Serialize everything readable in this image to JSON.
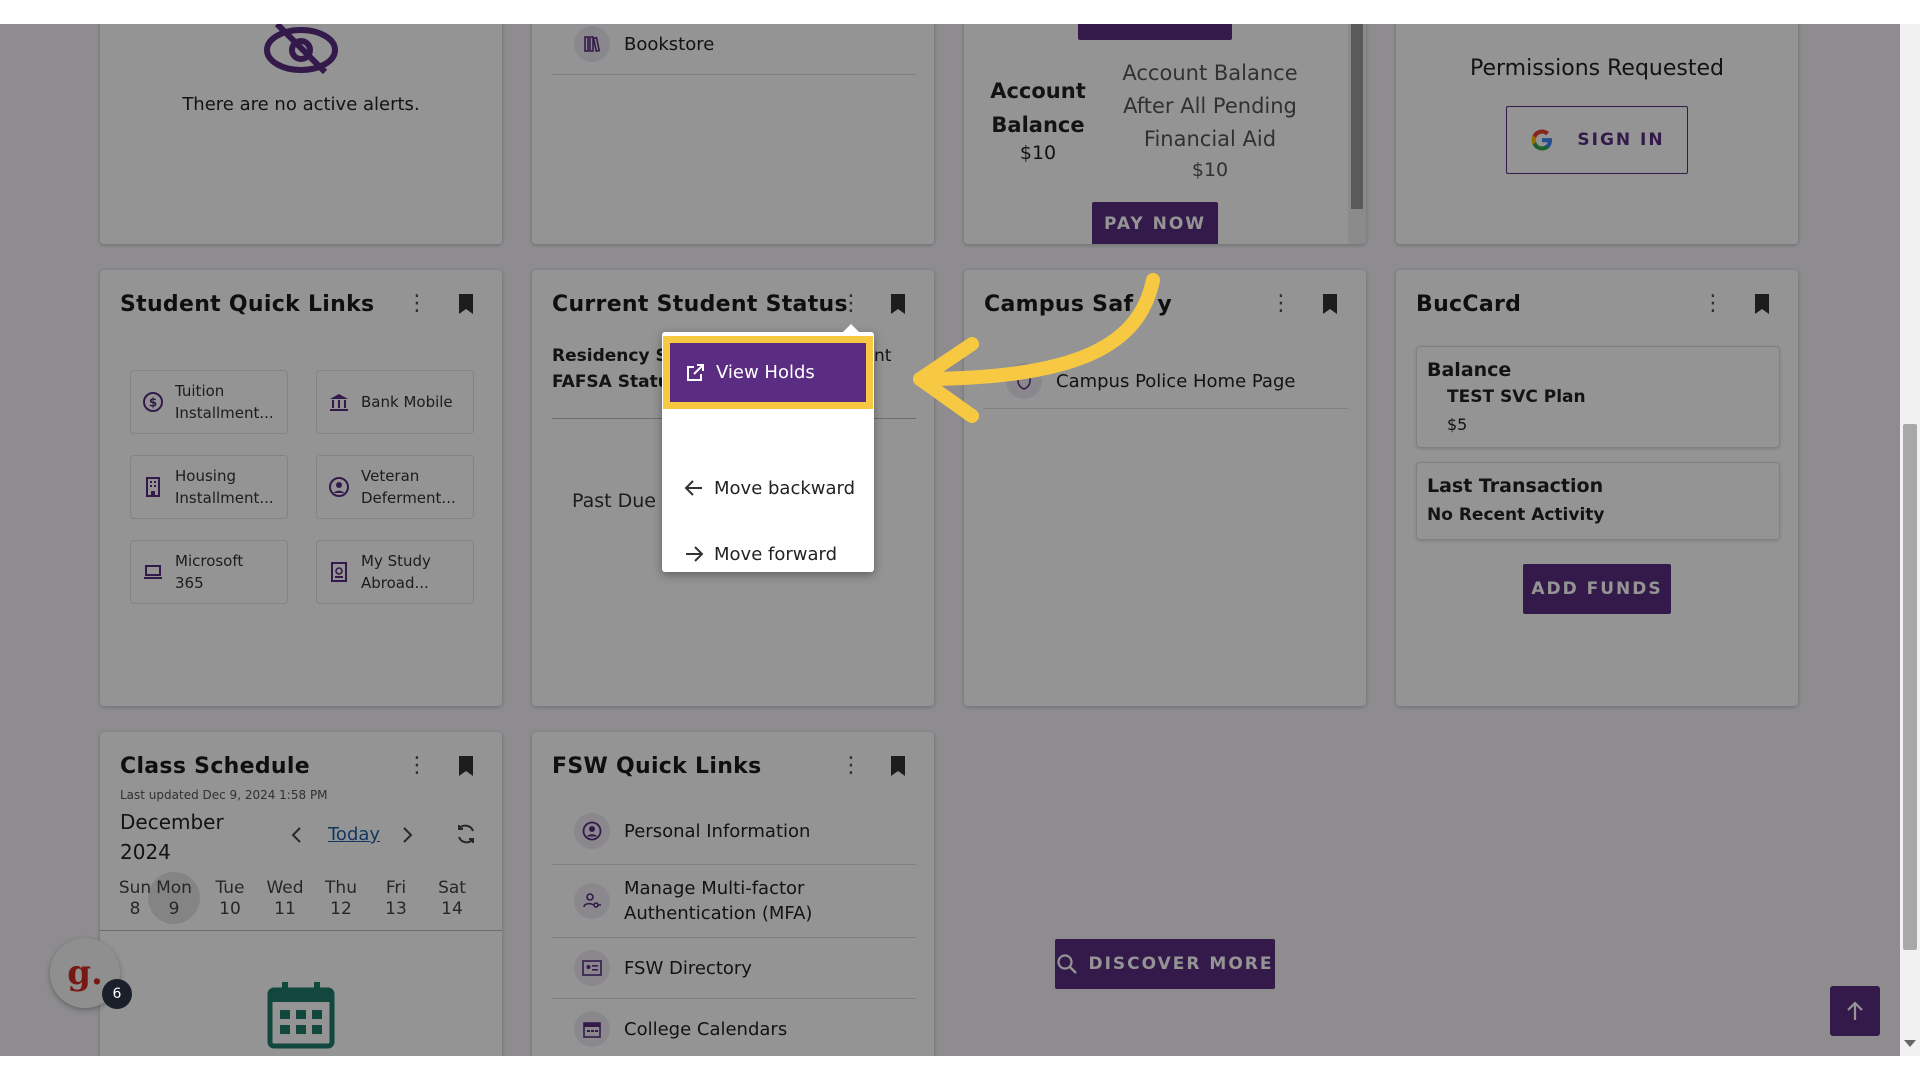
{
  "alerts": {
    "message": "There are no active alerts."
  },
  "resources": {
    "bookstore": "Bookstore"
  },
  "account": {
    "balance_label": "Account Balance",
    "balance_value": "$10",
    "pending_label": "Account Balance After All Pending Financial Aid",
    "pending_value": "$10",
    "pay_now": "PAY NOW"
  },
  "google": {
    "permissions": "Permissions Requested",
    "sign_in": "SIGN IN"
  },
  "quick_links": {
    "title": "Student Quick Links",
    "items": [
      {
        "label": "Tuition Installment...",
        "icon": "dollar-icon"
      },
      {
        "label": "Bank Mobile",
        "icon": "bank-icon"
      },
      {
        "label": "Housing Installment...",
        "icon": "building-icon"
      },
      {
        "label": "Veteran Deferment...",
        "icon": "person-icon"
      },
      {
        "label": "Microsoft 365",
        "icon": "laptop-icon"
      },
      {
        "label": "My Study Abroad...",
        "icon": "passport-icon"
      }
    ]
  },
  "status": {
    "title": "Current Student Status",
    "residency_label": "Residency St",
    "residency_suffix": "nt",
    "fafsa_label": "FAFSA Statu",
    "past_due": "Past Due"
  },
  "menu": {
    "view_holds": "View Holds",
    "move_backward": "Move backward",
    "move_forward": "Move forward"
  },
  "safety": {
    "title": "Campus Saf",
    "title_end": "y",
    "link": "Campus Police Home Page"
  },
  "buccard": {
    "title": "BucCard",
    "balance_label": "Balance",
    "plan": "TEST SVC Plan",
    "plan_value": "$5",
    "last_label": "Last Transaction",
    "last_value": "No Recent Activity",
    "add_funds": "ADD FUNDS"
  },
  "schedule": {
    "title": "Class Schedule",
    "updated": "Last updated Dec 9, 2024 1:58 PM",
    "month": "December",
    "year": "2024",
    "today": "Today",
    "days": [
      {
        "name": "Sun",
        "num": "8"
      },
      {
        "name": "Mon",
        "num": "9"
      },
      {
        "name": "Tue",
        "num": "10"
      },
      {
        "name": "Wed",
        "num": "11"
      },
      {
        "name": "Thu",
        "num": "12"
      },
      {
        "name": "Fri",
        "num": "13"
      },
      {
        "name": "Sat",
        "num": "14"
      }
    ]
  },
  "fsw": {
    "title": "FSW Quick Links",
    "items": [
      {
        "label": "Personal Information",
        "icon": "person-circle-icon"
      },
      {
        "label": "Manage Multi-factor Authentication (MFA)",
        "icon": "user-key-icon"
      },
      {
        "label": "FSW Directory",
        "icon": "id-card-icon"
      },
      {
        "label": "College Calendars",
        "icon": "calendar-icon"
      }
    ]
  },
  "discover": "DISCOVER MORE",
  "badge_count": "6",
  "colors": {
    "primary": "#5a2d82",
    "highlight": "#f7c942",
    "arrow": "#f7c942"
  }
}
